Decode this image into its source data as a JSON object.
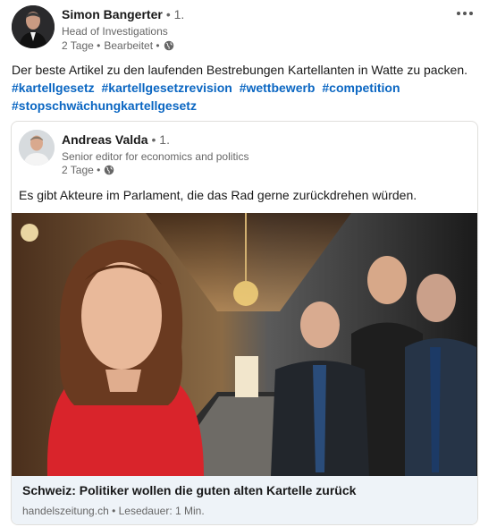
{
  "post": {
    "author": {
      "name": "Simon Bangerter",
      "degree": "• 1.",
      "headline": "Head of Investigations",
      "time": "2 Tage •",
      "edited": "Bearbeitet •"
    },
    "text": "Der beste Artikel zu den laufenden Bestrebungen Kartellanten in Watte zu packen.",
    "hashtags": [
      "#kartellgesetz",
      "#kartellgesetzrevision",
      "#wettbewerb",
      "#competition",
      "#stopschwächungkartellgesetz"
    ],
    "more_icon": "more-horizontal-icon",
    "visibility_icon": "globe-icon"
  },
  "shared": {
    "author": {
      "name": "Andreas Valda",
      "degree": "• 1.",
      "headline": "Senior editor for economics and politics",
      "time": "2 Tage •"
    },
    "text": "Es gibt Akteure im Parlament, die das Rad gerne zurückdrehen würden.",
    "article": {
      "title": "Schweiz: Politiker wollen die guten alten Kartelle zurück",
      "source": "handelszeitung.ch • Lesedauer: 1 Min."
    }
  },
  "colors": {
    "link": "#0a66c2",
    "muted": "#666666",
    "card_border": "#e0dfdc",
    "footer_bg": "#eef3f8"
  }
}
